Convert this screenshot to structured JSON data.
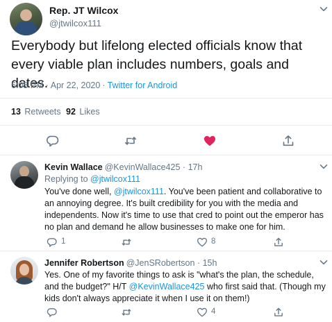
{
  "tweet": {
    "author_name": "Rep. JT Wilcox",
    "author_handle": "@jtwilcox111",
    "text": "Everybody but lifelong elected officials know that every viable plan includes numbers, goals and dates.",
    "time": "6:08 PM",
    "separator": "·",
    "date": "Apr 22, 2020",
    "source": "Twitter for Android",
    "retweets_count": "13",
    "retweets_label": "Retweets",
    "likes_count": "92",
    "likes_label": "Likes"
  },
  "replies": [
    {
      "name": "Kevin Wallace",
      "handle": "@KevinWallace425",
      "separator": "·",
      "age": "17h",
      "replying_label": "Replying to",
      "replying_to": "@jtwilcox111",
      "text_before_mention": "You've done well, ",
      "mention": "@jtwilcox111",
      "text_after_mention": ". You've  been patient and collaborative to an annoying degree. It's built credibility for you with the media and independents. Now it's time to use that cred to point out the emperor has no plan and demand he allow businesses to make one for him.",
      "reply_count": "1",
      "like_count": "8"
    },
    {
      "name": "Jennifer Robertson",
      "handle": "@JenSRobertson",
      "separator": "·",
      "age": "15h",
      "text_before_mention": "Yes. One of my favorite things to ask is \"what's the plan, the schedule, and the budget?\" H/T ",
      "mention": "@KevinWallace425",
      "text_after_mention": " who first said that. (Though my kids don't always appreciate it when I use it on them!)",
      "like_count": "4"
    }
  ],
  "colors": {
    "link": "#1b95e0",
    "muted": "#657786",
    "like_active": "#e0245e",
    "divider": "#e6ecf0"
  },
  "icons": [
    "chevron-down-icon",
    "reply-icon",
    "retweet-icon",
    "heart-icon",
    "share-icon"
  ]
}
